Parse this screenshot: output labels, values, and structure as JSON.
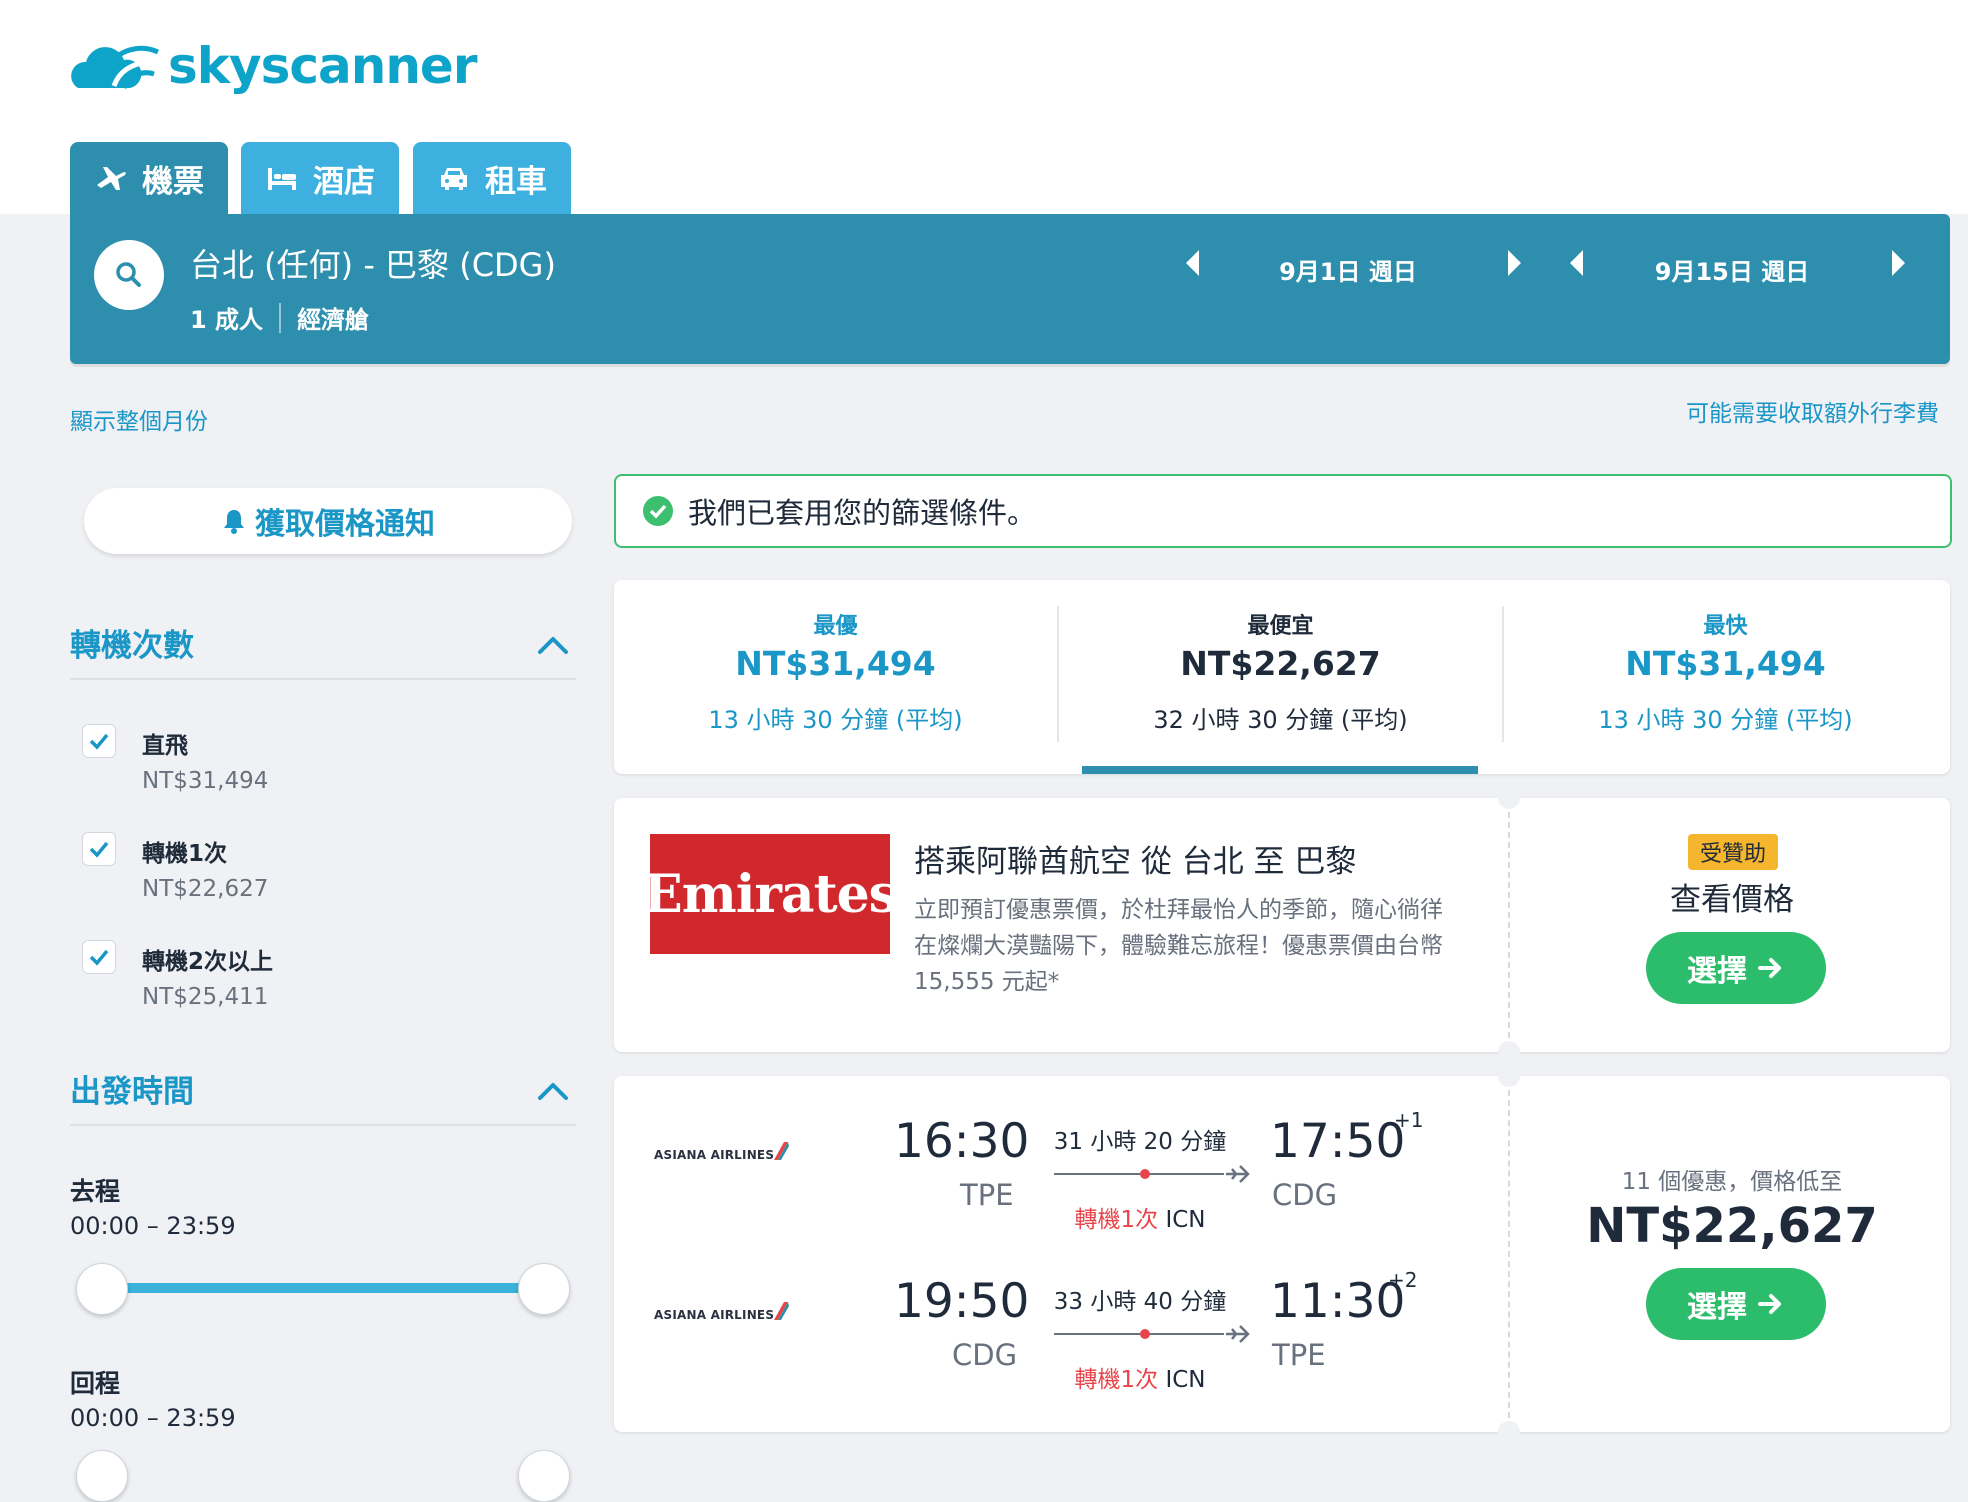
{
  "brand": {
    "name": "skyscanner",
    "color": "#0ea3c9"
  },
  "tabs": [
    {
      "label": "機票",
      "icon": "plane-icon",
      "active": true
    },
    {
      "label": "酒店",
      "icon": "bed-icon",
      "active": false
    },
    {
      "label": "租車",
      "icon": "car-icon",
      "active": false
    }
  ],
  "search": {
    "route": "台北 (任何) - 巴黎 (CDG)",
    "passengers": "1 成人",
    "cabin": "經濟艙",
    "depart_date": "9月1日 週日",
    "return_date": "9月15日 週日"
  },
  "links": {
    "whole_month": "顯示整個月份",
    "baggage_fee": "可能需要收取額外行李費"
  },
  "sidebar": {
    "price_alert": "獲取價格通知",
    "stops": {
      "title": "轉機次數",
      "options": [
        {
          "label": "直飛",
          "price": "NT$31,494",
          "checked": true
        },
        {
          "label": "轉機1次",
          "price": "NT$22,627",
          "checked": true
        },
        {
          "label": "轉機2次以上",
          "price": "NT$25,411",
          "checked": true
        }
      ]
    },
    "departure_times": {
      "title": "出發時間",
      "outbound_label": "去程",
      "outbound_range": "00:00 – 23:59",
      "return_label": "回程",
      "return_range": "00:00 – 23:59"
    }
  },
  "notice": "我們已套用您的篩選條件。",
  "sort": [
    {
      "label": "最優",
      "price": "NT$31,494",
      "duration": "13 小時 30 分鐘 (平均)"
    },
    {
      "label": "最便宜",
      "price": "NT$22,627",
      "duration": "32 小時 30 分鐘 (平均)",
      "selected": true
    },
    {
      "label": "最快",
      "price": "NT$31,494",
      "duration": "13 小時 30 分鐘 (平均)"
    }
  ],
  "ad": {
    "logo_text": "Emirates",
    "title": "搭乘阿聯酋航空 從 台北 至 巴黎",
    "body": "立即預訂優惠票價，於杜拜最怡人的季節，隨心徜徉在燦爛大漠豔陽下，體驗難忘旅程！優惠票價由台幣 15,555 元起*",
    "sponsored": "受贊助",
    "view_price": "查看價格",
    "select": "選擇"
  },
  "result": {
    "airline": "ASIANA AIRLINES",
    "legs": [
      {
        "dep_time": "16:30",
        "dep_code": "TPE",
        "duration": "31 小時 20 分鐘",
        "arr_time": "17:50",
        "arr_plus": "+1",
        "arr_code": "CDG",
        "stops": "轉機1次",
        "via": "ICN"
      },
      {
        "dep_time": "19:50",
        "dep_code": "CDG",
        "duration": "33 小時 40 分鐘",
        "arr_time": "11:30",
        "arr_plus": "+2",
        "arr_code": "TPE",
        "stops": "轉機1次",
        "via": "ICN"
      }
    ],
    "deals": "11 個優惠，價格低至",
    "price": "NT$22,627",
    "select": "選擇"
  },
  "colors": {
    "primary": "#2d8fad",
    "tab": "#3db0e0",
    "link": "#1a96c7",
    "green": "#2bbd6b",
    "red": "#e8454a"
  }
}
